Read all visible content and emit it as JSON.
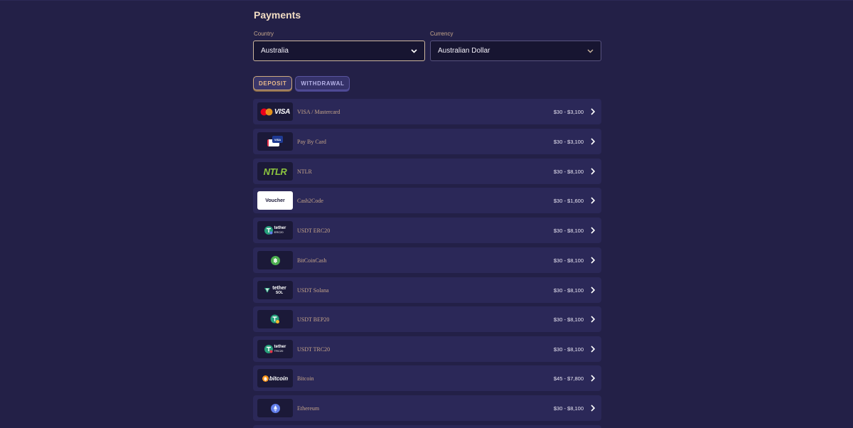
{
  "page": {
    "title": "Payments"
  },
  "filters": {
    "country": {
      "label": "Country",
      "value": "Australia"
    },
    "currency": {
      "label": "Currency",
      "value": "Australian Dollar"
    }
  },
  "tabs": [
    {
      "label": "DEPOSIT",
      "active": true
    },
    {
      "label": "WITHDRAWAL",
      "active": false
    }
  ],
  "methods": [
    {
      "name": "VISA / Mastercard",
      "range": "$30 - $3,100",
      "logo": "visa-mastercard-icon",
      "logo_text": "VISA"
    },
    {
      "name": "Pay By Card",
      "range": "$30 - $3,100",
      "logo": "card-icon",
      "logo_text": "VISA"
    },
    {
      "name": "NTLR",
      "range": "$30 - $8,100",
      "logo": "ntlr-logo",
      "logo_text": "NTLR"
    },
    {
      "name": "Cash2Code",
      "range": "$30 - $1,600",
      "logo": "voucher-logo",
      "logo_text": "Voucher"
    },
    {
      "name": "USDT ERC20",
      "range": "$30 - $8,100",
      "logo": "tether-erc20-icon",
      "logo_text": "tether",
      "logo_sub": "ERC20"
    },
    {
      "name": "BitCoinCash",
      "range": "$30 - $8,100",
      "logo": "bitcoincash-icon"
    },
    {
      "name": "USDT Solana",
      "range": "$30 - $8,100",
      "logo": "tether-sol-icon",
      "logo_text": "tether",
      "logo_sub": "SOL"
    },
    {
      "name": "USDT BEP20",
      "range": "$30 - $8,100",
      "logo": "tether-bep20-icon"
    },
    {
      "name": "USDT TRC20",
      "range": "$30 - $8,100",
      "logo": "tether-trc20-icon",
      "logo_text": "tether",
      "logo_sub": "TRC20"
    },
    {
      "name": "Bitcoin",
      "range": "$45 - $7,800",
      "logo": "bitcoin-logo",
      "logo_text": "bitcoin"
    },
    {
      "name": "Ethereum",
      "range": "$30 - $8,100",
      "logo": "ethereum-icon"
    }
  ],
  "colors": {
    "background": "#232047",
    "row": "#2b2858",
    "title": "#f1dcc3",
    "method_name": "#c6a589",
    "accent": "#cda97e"
  }
}
